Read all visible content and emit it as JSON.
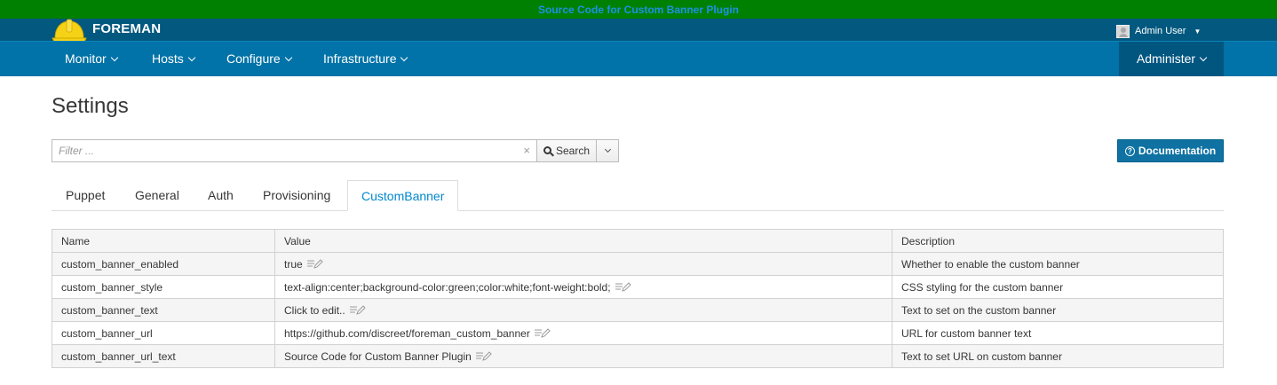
{
  "banner": {
    "link_text": "Source Code for Custom Banner Plugin",
    "bg_color": "#008000",
    "link_color": "#1e90e6"
  },
  "header": {
    "brand": "FOREMAN",
    "logo_icon": "hard-hat-icon",
    "user_name": "Admin User",
    "user_icon": "avatar-icon"
  },
  "nav": {
    "items": [
      "Monitor",
      "Hosts",
      "Configure",
      "Infrastructure"
    ],
    "admin": "Administer",
    "bar_color": "#0173a8"
  },
  "page": {
    "title": "Settings"
  },
  "search": {
    "placeholder": "Filter ...",
    "value": "",
    "button_label": "Search",
    "clear_glyph": "×"
  },
  "documentation": {
    "label": "Documentation",
    "icon": "question-circle-icon"
  },
  "tabs": {
    "items": [
      "Puppet",
      "General",
      "Auth",
      "Provisioning",
      "CustomBanner"
    ],
    "active": "CustomBanner"
  },
  "table": {
    "headers": [
      "Name",
      "Value",
      "Description"
    ],
    "rows": [
      {
        "name": "custom_banner_enabled",
        "value": "true",
        "description": "Whether to enable the custom banner"
      },
      {
        "name": "custom_banner_style",
        "value": "text-align:center;background-color:green;color:white;font-weight:bold;",
        "description": "CSS styling for the custom banner"
      },
      {
        "name": "custom_banner_text",
        "value": "Click to edit..",
        "description": "Text to set on the custom banner"
      },
      {
        "name": "custom_banner_url",
        "value": "https://github.com/discreet/foreman_custom_banner",
        "description": "URL for custom banner text"
      },
      {
        "name": "custom_banner_url_text",
        "value": "Source Code for Custom Banner Plugin",
        "description": "Text to set URL on custom banner"
      }
    ]
  }
}
